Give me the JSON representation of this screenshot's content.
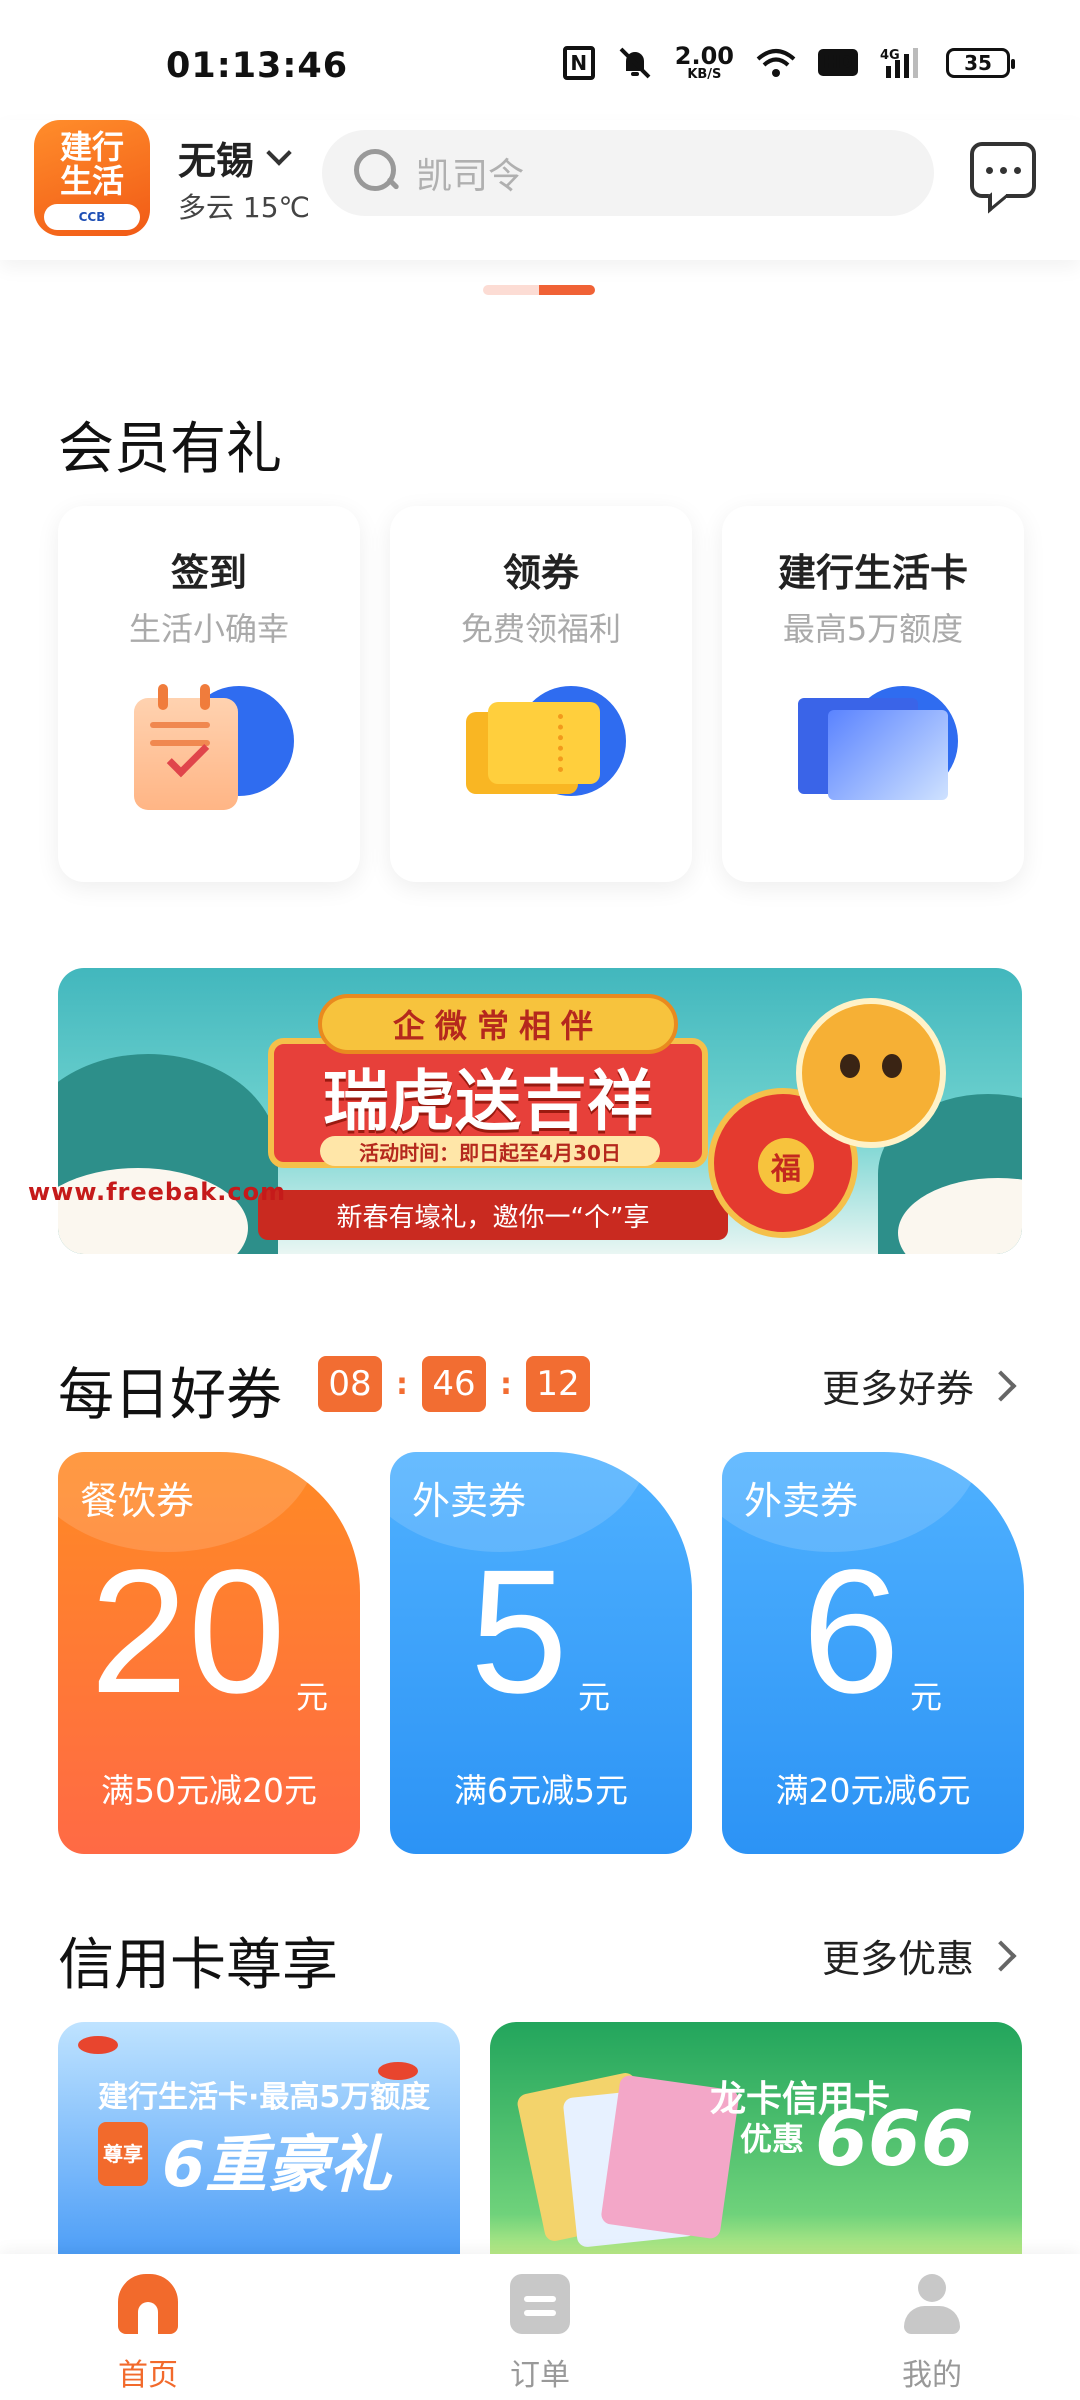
{
  "status_bar": {
    "time": "01:13:46",
    "net_speed": "2.00",
    "net_unit": "KB/S",
    "hd": "HD",
    "net_type": "4G",
    "battery": "35"
  },
  "header": {
    "logo_text": "建行生活",
    "logo_sub": "CCB",
    "city": "无锡",
    "weather": "多云 15℃",
    "search_placeholder": "凯司令"
  },
  "member": {
    "title": "会员有礼",
    "cards": [
      {
        "title": "签到",
        "subtitle": "生活小确幸",
        "icon": "calendar-icon"
      },
      {
        "title": "领券",
        "subtitle": "免费领福利",
        "icon": "ticket-icon"
      },
      {
        "title": "建行生活卡",
        "subtitle": "最高5万额度",
        "icon": "card-icon"
      }
    ]
  },
  "banner": {
    "tag": "企微常相伴",
    "title": "瑞虎送吉祥",
    "date": "活动时间：即日起至4月30日",
    "bottom": "新春有壕礼，邀你一“个”享",
    "fu": "福",
    "watermark": "www.freebak.com"
  },
  "daily": {
    "title": "每日好券",
    "timer": [
      "08",
      "46",
      "12"
    ],
    "more": "更多好券",
    "coupons": [
      {
        "type": "餐饮券",
        "amount": "20",
        "unit": "元",
        "rule": "满50元减20元",
        "color": "#ff7a35"
      },
      {
        "type": "外卖券",
        "amount": "5",
        "unit": "元",
        "rule": "满6元减5元",
        "color": "#3aa2fb"
      },
      {
        "type": "外卖券",
        "amount": "6",
        "unit": "元",
        "rule": "满20元减6元",
        "color": "#3aa2fb"
      }
    ]
  },
  "credit": {
    "title": "信用卡尊享",
    "more": "更多优惠",
    "card1": {
      "line1": "建行生活卡·最高5万额度",
      "tag": "尊享",
      "line2": "6重豪礼"
    },
    "card2": {
      "line1": "龙卡信用卡",
      "line2": "优惠",
      "big": "666"
    }
  },
  "tabbar": {
    "home": "首页",
    "orders": "订单",
    "me": "我的"
  },
  "colors": {
    "accent": "#f26a2c",
    "coupon_blue": "#3aa2fb",
    "coupon_orange": "#ff7a35"
  }
}
